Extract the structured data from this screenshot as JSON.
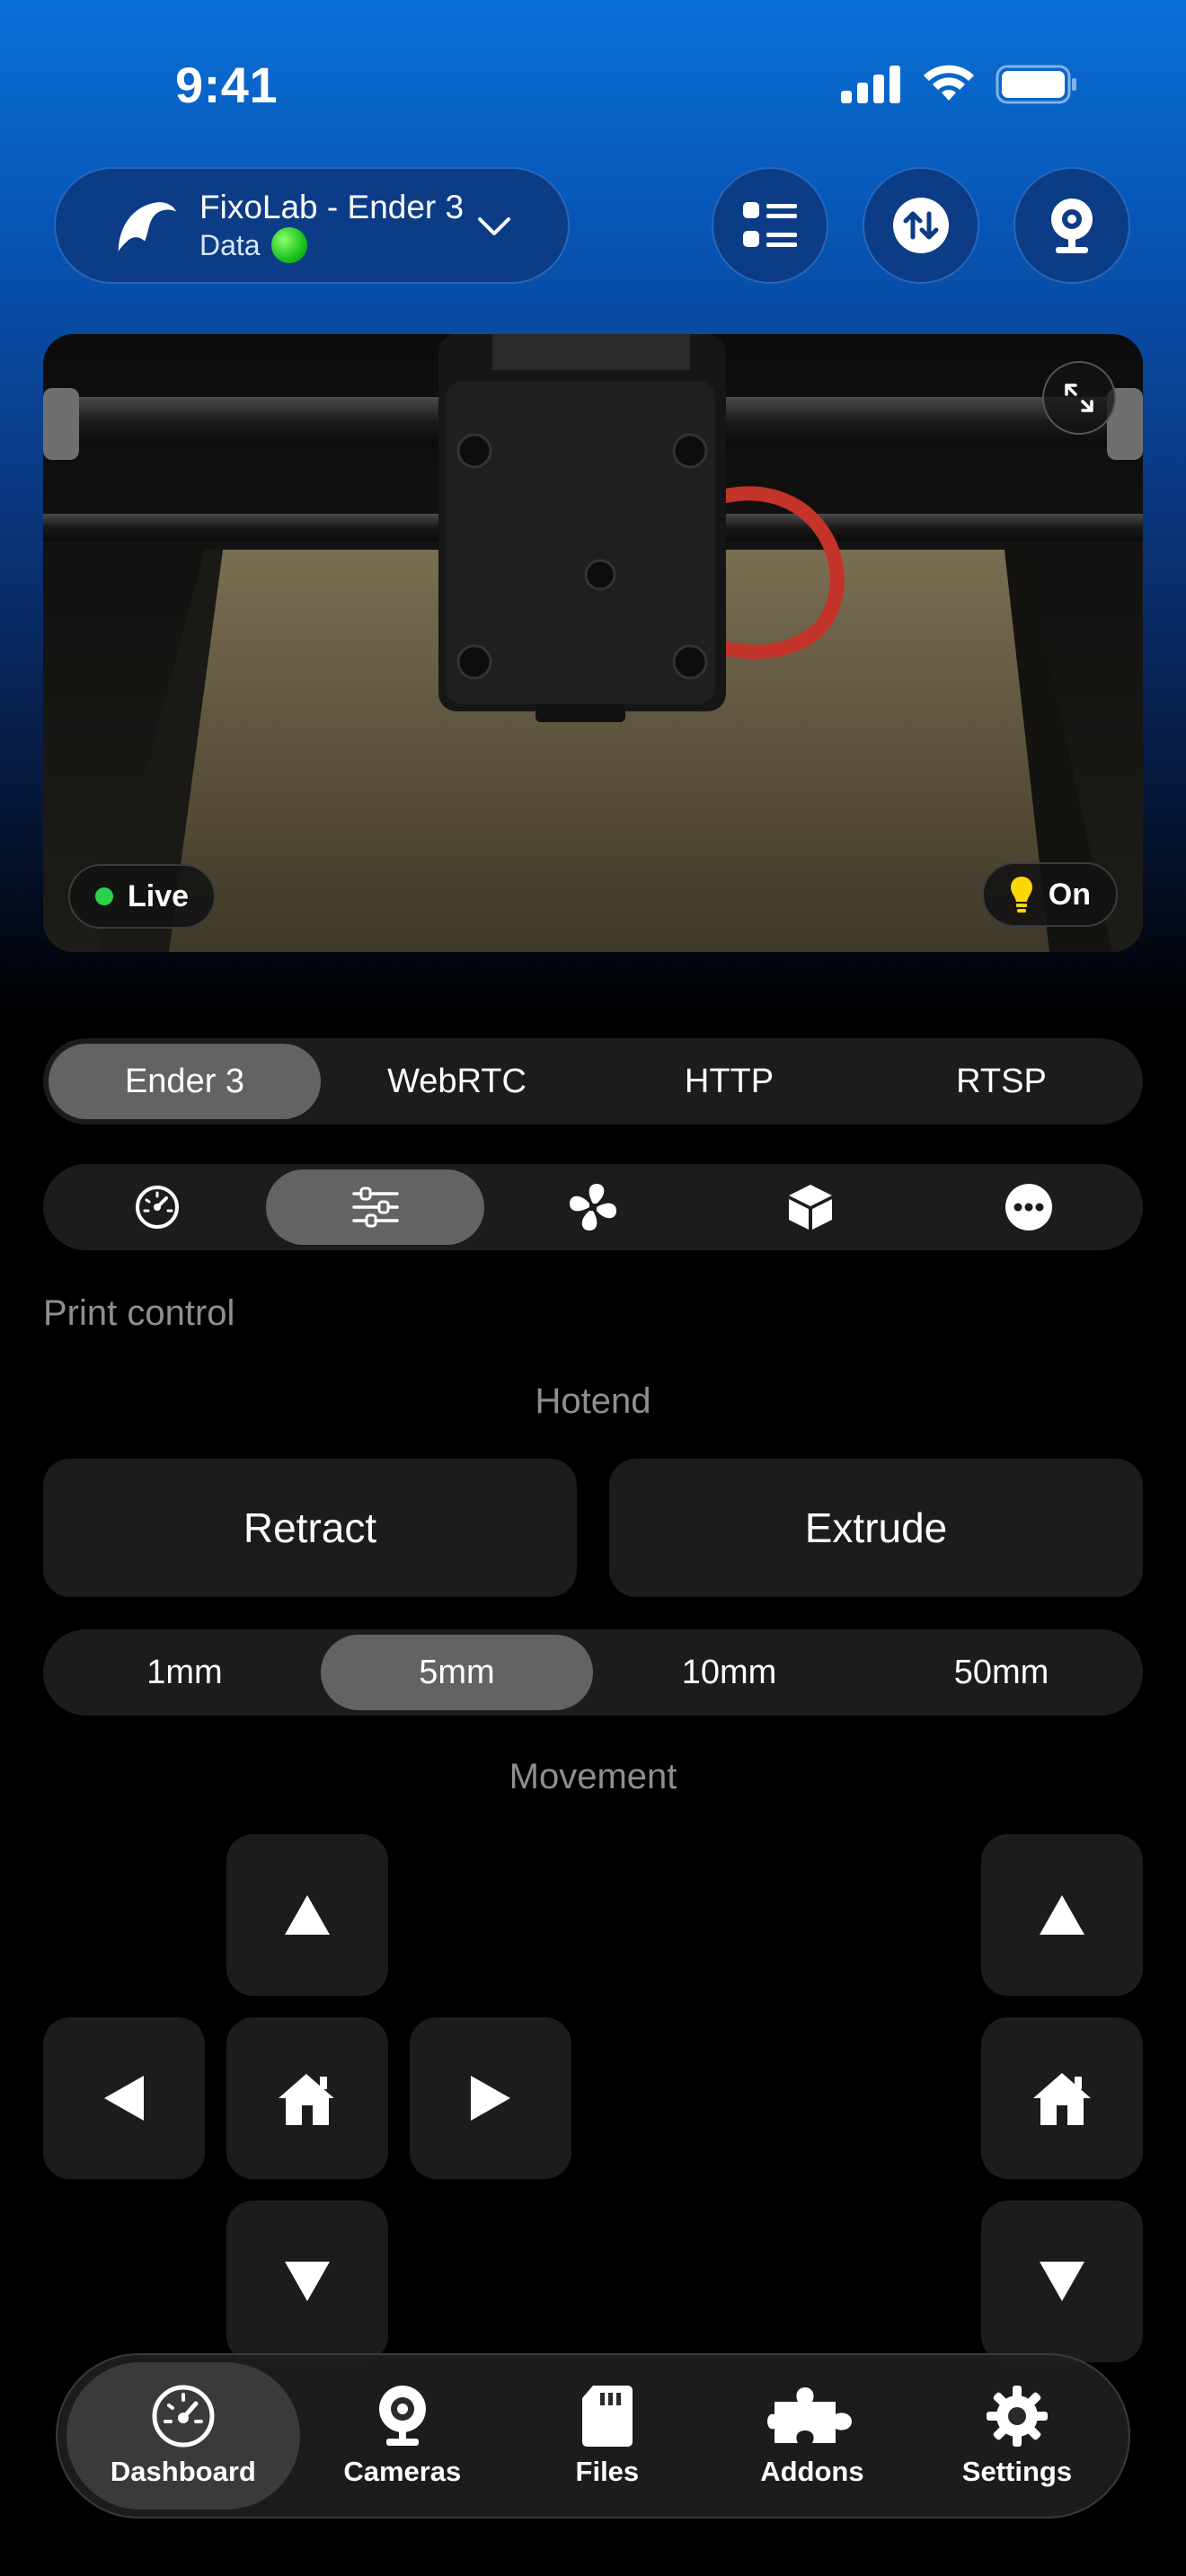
{
  "status_bar": {
    "time": "9:41"
  },
  "header": {
    "printer_name": "FixoLab - Ender 3",
    "printer_sub": "Data",
    "status_color": "#18c21e"
  },
  "camera": {
    "live_label": "Live",
    "light_label": "On"
  },
  "camera_tabs": [
    {
      "label": "Ender 3",
      "active": true
    },
    {
      "label": "WebRTC",
      "active": false
    },
    {
      "label": "HTTP",
      "active": false
    },
    {
      "label": "RTSP",
      "active": false
    }
  ],
  "control_tabs": [
    {
      "icon": "gauge-icon",
      "active": false
    },
    {
      "icon": "sliders-icon",
      "active": true
    },
    {
      "icon": "fan-icon",
      "active": false
    },
    {
      "icon": "box-icon",
      "active": false
    },
    {
      "icon": "more-icon",
      "active": false
    }
  ],
  "print_control": {
    "title": "Print control",
    "hotend_title": "Hotend",
    "retract_label": "Retract",
    "extrude_label": "Extrude",
    "distances": [
      {
        "label": "1mm",
        "active": false
      },
      {
        "label": "5mm",
        "active": true
      },
      {
        "label": "10mm",
        "active": false
      },
      {
        "label": "50mm",
        "active": false
      }
    ],
    "movement_title": "Movement"
  },
  "tabbar": {
    "items": [
      {
        "label": "Dashboard",
        "icon": "speedometer-icon",
        "active": true
      },
      {
        "label": "Cameras",
        "icon": "webcam-icon",
        "active": false
      },
      {
        "label": "Files",
        "icon": "sd-card-icon",
        "active": false
      },
      {
        "label": "Addons",
        "icon": "puzzle-icon",
        "active": false
      },
      {
        "label": "Settings",
        "icon": "gear-icon",
        "active": false
      }
    ]
  },
  "colors": {
    "accent_blue": "#0a6fd6",
    "surface": "#1c1c1e",
    "active_segment": "#636366",
    "live_green": "#2bd14b",
    "secondary_text": "#8e8e93"
  }
}
